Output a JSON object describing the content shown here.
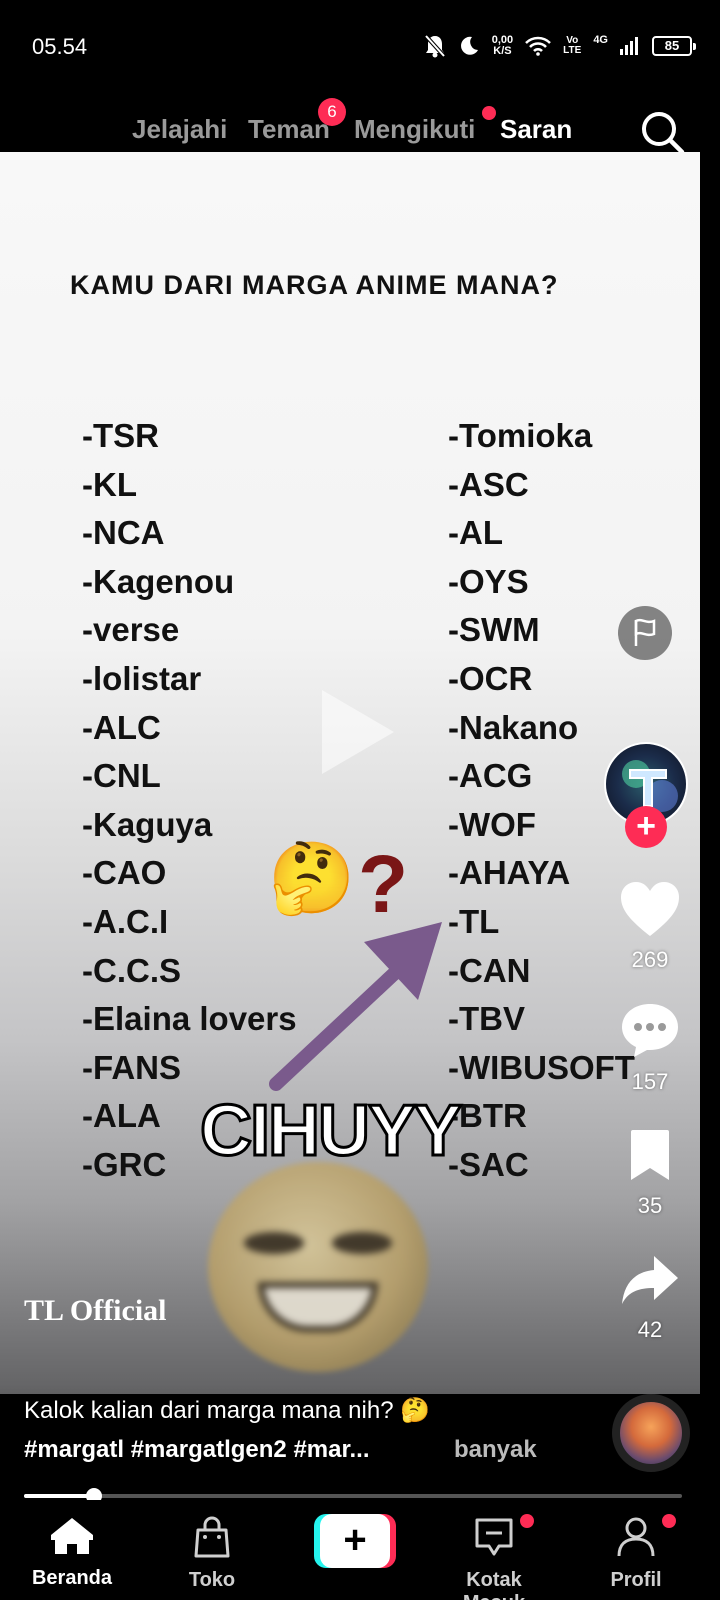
{
  "status_bar": {
    "time": "05.54",
    "net_speed_value": "0,00",
    "net_speed_unit": "K/S",
    "volte_top": "Vo",
    "volte_bottom": "LTE",
    "network": "4G",
    "battery": "85",
    "icons": [
      "mute-bell-icon",
      "moon-icon",
      "wifi-icon",
      "signal-icon",
      "battery-icon"
    ]
  },
  "top_nav": {
    "tabs": [
      {
        "label": "Jelajahi"
      },
      {
        "label": "Teman",
        "badge": "6"
      },
      {
        "label": "Mengikuti"
      },
      {
        "label": "Saran",
        "active": true
      }
    ],
    "search_icon": "search-icon"
  },
  "video": {
    "title": "KAMU DARI MARGA ANIME MANA?",
    "clans_left": [
      "-TSR",
      "-KL",
      "-NCA",
      "-Kagenou",
      "-verse",
      "-lolistar",
      "-ALC",
      "-CNL",
      "-Kaguya",
      "-CAO",
      "-A.C.I",
      "-C.C.S",
      "-Elaina lovers",
      "-FANS",
      "-ALA",
      "-GRC"
    ],
    "clans_right": [
      "-Tomioka",
      "-ASC",
      "-AL",
      "-OYS",
      "-SWM",
      "-OCR",
      "-Nakano",
      "-ACG",
      "-WOF",
      "-AHAYA",
      "-TL",
      "-CAN",
      "-TBV",
      "-WIBUSOFT",
      "-BTR",
      "-SAC"
    ],
    "emoji": "🤔",
    "question_mark": "?",
    "overlay_text": "CIHUYY"
  },
  "sidebar": {
    "likes": "269",
    "comments": "157",
    "bookmarks": "35",
    "shares": "42",
    "icons": [
      "flag-icon",
      "heart-icon",
      "comment-icon",
      "bookmark-icon",
      "share-icon"
    ]
  },
  "caption": {
    "author": "TL Official",
    "text": "Kalok kalian dari marga mana nih? 🤔",
    "hashtags": "#margatl #margatlgen2 #mar...",
    "more": "banyak"
  },
  "progress": {
    "fraction": 0.107
  },
  "bottom_nav": {
    "items": [
      {
        "label": "Beranda",
        "active": true,
        "icon": "home-icon"
      },
      {
        "label": "Toko",
        "icon": "shopping-bag-icon"
      },
      {
        "label": "",
        "icon": "plus-icon"
      },
      {
        "label": "Kotak Masuk",
        "icon": "inbox-icon",
        "dot": true
      },
      {
        "label": "Profil",
        "icon": "profile-icon",
        "dot": true
      }
    ]
  },
  "colors": {
    "accent": "#fe2c55",
    "accent_cyan": "#25f4ee",
    "tab_inactive": "#9a9a9a"
  }
}
